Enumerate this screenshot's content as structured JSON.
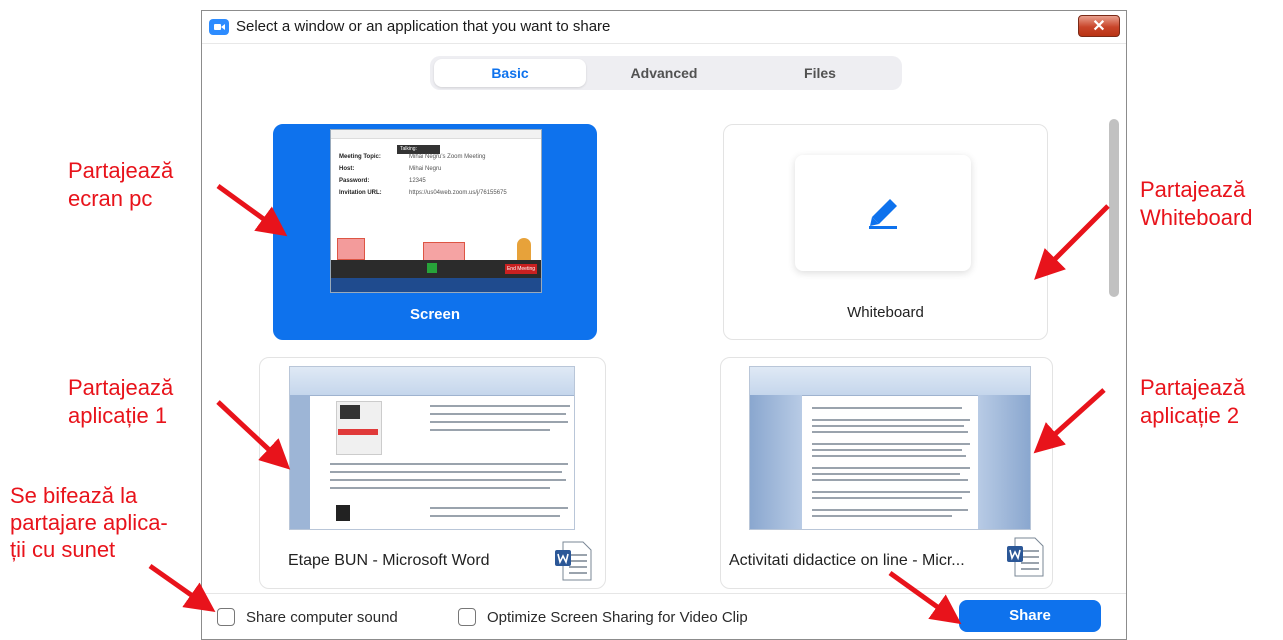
{
  "window": {
    "title": "Select a window or an application that you want to share",
    "close_glyph": "✕"
  },
  "tabs": [
    {
      "label": "Basic",
      "active": true
    },
    {
      "label": "Advanced",
      "active": false
    },
    {
      "label": "Files",
      "active": false
    }
  ],
  "tiles": {
    "screen": {
      "label": "Screen",
      "thumb": {
        "rows": [
          {
            "k": "Meeting Topic:",
            "v": "Mihai Negru's Zoom Meeting"
          },
          {
            "k": "Host:",
            "v": "Mihai Negru"
          },
          {
            "k": "Password:",
            "v": "12345"
          },
          {
            "k": "Invitation URL:",
            "v": "https://us04web.zoom.us/j/76155675"
          }
        ],
        "talking": "Talking:",
        "end_meeting": "End Meeting"
      }
    },
    "whiteboard": {
      "label": "Whiteboard"
    },
    "app1": {
      "label": "Etape BUN - Microsoft Word"
    },
    "app2": {
      "label": "Activitati didactice on line - Micr..."
    }
  },
  "options": {
    "share_sound": {
      "label": "Share computer sound",
      "checked": false
    },
    "optimize_video": {
      "label": "Optimize Screen Sharing for Video Clip",
      "checked": false
    }
  },
  "share_button": {
    "label": "Share"
  },
  "annotations": {
    "screen": [
      "Partajează",
      "ecran pc"
    ],
    "whiteboard": [
      "Partajează",
      "Whiteboard"
    ],
    "app1": [
      "Partajează",
      "aplicație 1"
    ],
    "app2": [
      "Partajează",
      "aplicație 2"
    ],
    "sound": [
      "Se bifează la",
      "partajare aplica-",
      "ții cu sunet"
    ]
  },
  "colors": {
    "accent": "#0e72ed",
    "annotation": "#e8131b"
  },
  "icons": {
    "app": "zoom-logo",
    "close": "close-icon",
    "whiteboard": "pen-icon",
    "word": "word-document-icon"
  }
}
